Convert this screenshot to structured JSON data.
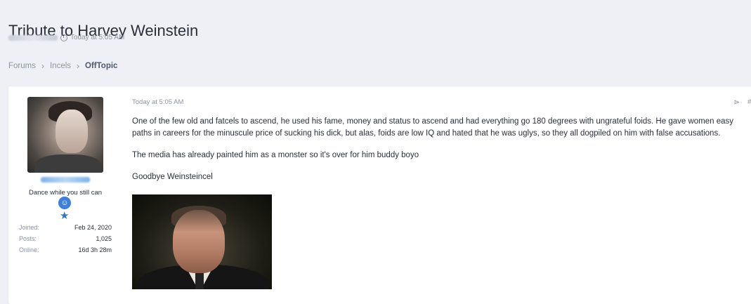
{
  "thread": {
    "title": "Tribute to Harvey Weinstein",
    "timestamp": "Today at 5:05 AM"
  },
  "breadcrumb": {
    "items": [
      "Forums",
      "Incels",
      "OffTopic"
    ],
    "separator": "›"
  },
  "author": {
    "user_title": "Dance while you still can",
    "stats": [
      {
        "label": "Joined:",
        "value": "Feb 24, 2020"
      },
      {
        "label": "Posts:",
        "value": "1,025"
      },
      {
        "label": "Online:",
        "value": "16d 3h 28m"
      }
    ]
  },
  "post": {
    "date": "Today at 5:05 AM",
    "paragraphs": [
      "One of the few old and fatcels to ascend, he used his fame, money and status to ascend and had everything go 180 degrees with ungrateful foids. He gave women easy paths in careers for the minuscule price of sucking his dick, but alas, foids are low IQ and hated that he was uglys, so they all dogpiled on him with false accusations.",
      "The media has already painted him as a monster so it's over for him buddy boyo",
      "Goodbye Weinsteincel"
    ]
  },
  "icons": {
    "clock": "clock-icon",
    "share": "share-icon",
    "badge_user": "user-badge-icon",
    "badge_star": "star-icon"
  },
  "colors": {
    "background": "#eef0f6",
    "card": "#ffffff",
    "muted_text": "#8c93a3",
    "accent_blue": "#3d7fd9"
  }
}
